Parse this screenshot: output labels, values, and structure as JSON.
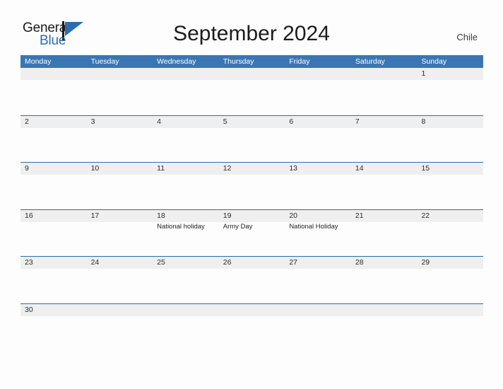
{
  "brand": {
    "name_part1": "General",
    "name_part2": "Blue",
    "logo_icon": "triangle-flag-icon",
    "accent_color": "#2a6db0"
  },
  "header": {
    "title": "September 2024",
    "country": "Chile"
  },
  "colors": {
    "header_blue": "#3a76b3",
    "row_rule_blue": "#2a6db0",
    "band_gray": "#efefef",
    "page_background": "#fdfdfd",
    "text_dark": "#1c1c1c"
  },
  "calendar": {
    "month": "September",
    "year": "2024",
    "week_start": "Monday",
    "weekdays": [
      "Monday",
      "Tuesday",
      "Wednesday",
      "Thursday",
      "Friday",
      "Saturday",
      "Sunday"
    ],
    "weeks": [
      [
        {
          "day": "",
          "events": []
        },
        {
          "day": "",
          "events": []
        },
        {
          "day": "",
          "events": []
        },
        {
          "day": "",
          "events": []
        },
        {
          "day": "",
          "events": []
        },
        {
          "day": "",
          "events": []
        },
        {
          "day": "1",
          "events": []
        }
      ],
      [
        {
          "day": "2",
          "events": []
        },
        {
          "day": "3",
          "events": []
        },
        {
          "day": "4",
          "events": []
        },
        {
          "day": "5",
          "events": []
        },
        {
          "day": "6",
          "events": []
        },
        {
          "day": "7",
          "events": []
        },
        {
          "day": "8",
          "events": []
        }
      ],
      [
        {
          "day": "9",
          "events": []
        },
        {
          "day": "10",
          "events": []
        },
        {
          "day": "11",
          "events": []
        },
        {
          "day": "12",
          "events": []
        },
        {
          "day": "13",
          "events": []
        },
        {
          "day": "14",
          "events": []
        },
        {
          "day": "15",
          "events": []
        }
      ],
      [
        {
          "day": "16",
          "events": []
        },
        {
          "day": "17",
          "events": []
        },
        {
          "day": "18",
          "events": [
            "National holiday"
          ]
        },
        {
          "day": "19",
          "events": [
            "Army Day"
          ]
        },
        {
          "day": "20",
          "events": [
            "National Holiday"
          ]
        },
        {
          "day": "21",
          "events": []
        },
        {
          "day": "22",
          "events": []
        }
      ],
      [
        {
          "day": "23",
          "events": []
        },
        {
          "day": "24",
          "events": []
        },
        {
          "day": "25",
          "events": []
        },
        {
          "day": "26",
          "events": []
        },
        {
          "day": "27",
          "events": []
        },
        {
          "day": "28",
          "events": []
        },
        {
          "day": "29",
          "events": []
        }
      ],
      [
        {
          "day": "30",
          "events": []
        },
        {
          "day": "",
          "events": []
        },
        {
          "day": "",
          "events": []
        },
        {
          "day": "",
          "events": []
        },
        {
          "day": "",
          "events": []
        },
        {
          "day": "",
          "events": []
        },
        {
          "day": "",
          "events": []
        }
      ]
    ]
  }
}
